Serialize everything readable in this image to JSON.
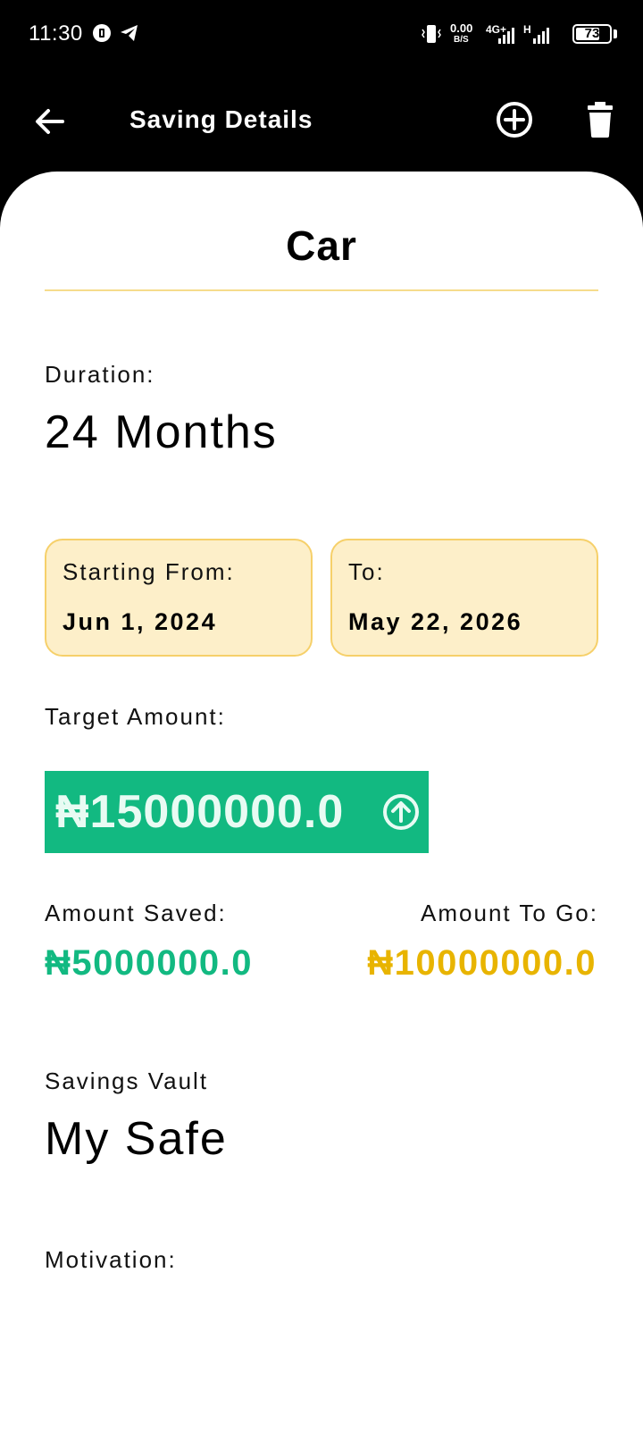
{
  "status_bar": {
    "time": "11:30",
    "net_speed_value": "0.00",
    "net_speed_unit": "B/S",
    "network_type": "4G+",
    "network_type_2": "H",
    "battery": "73",
    "battery_level": 0.73
  },
  "app_bar": {
    "title": "Saving Details"
  },
  "saving": {
    "name": "Car",
    "duration_label": "Duration:",
    "duration_value": "24 Months",
    "start_label": "Starting From:",
    "start_value": "Jun 1, 2024",
    "end_label": "To:",
    "end_value": "May 22, 2026",
    "target_label": "Target Amount:",
    "target_value": "₦15000000.0",
    "saved_label": "Amount Saved:",
    "saved_value": "₦5000000.0",
    "togo_label": "Amount To Go:",
    "togo_value": "₦10000000.0",
    "vault_label": "Savings Vault",
    "vault_value": "My Safe",
    "motivation_label": "Motivation:",
    "motivation_value": ""
  },
  "colors": {
    "accent_green": "#12b981",
    "accent_yellow": "#e8b400",
    "card_bg": "#fdefc9",
    "card_border": "#f6d06a"
  },
  "icons": {
    "back": "arrow-left-icon",
    "add": "plus-circle-icon",
    "delete": "trash-icon",
    "target_action": "arrow-up-circle-icon"
  }
}
